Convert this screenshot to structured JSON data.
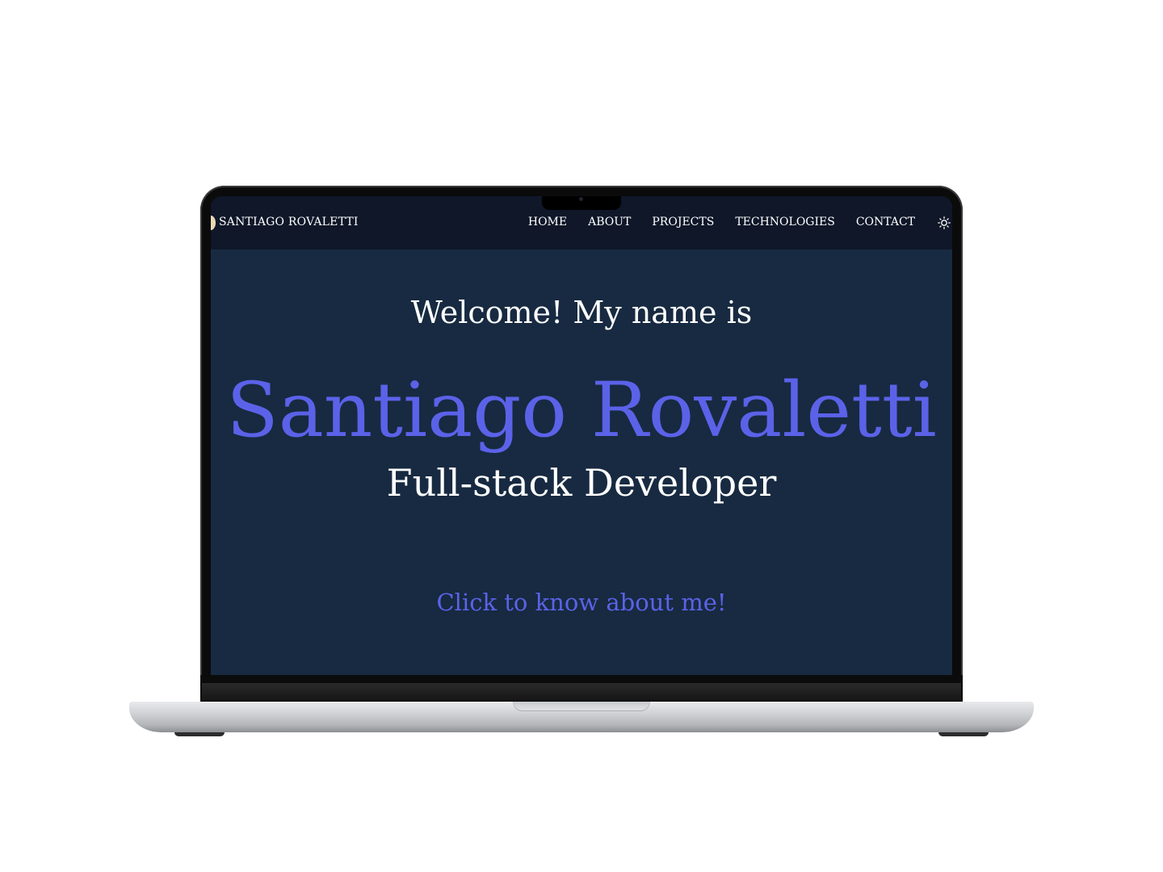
{
  "nav": {
    "brand": "SANTIAGO ROVALETTI",
    "links": [
      {
        "label": "HOME"
      },
      {
        "label": "ABOUT"
      },
      {
        "label": "PROJECTS"
      },
      {
        "label": "TECHNOLOGIES"
      },
      {
        "label": "CONTACT"
      }
    ],
    "theme_toggle_icon": "sun-icon"
  },
  "hero": {
    "greeting": "Welcome! My name is",
    "name": "Santiago Rovaletti",
    "role": "Full-stack Developer",
    "cta": "Click to know about me!"
  },
  "colors": {
    "page_background": "#172a41",
    "navbar_background": "#0f1729",
    "accent": "#5b62e8",
    "text": "#ffffff"
  }
}
